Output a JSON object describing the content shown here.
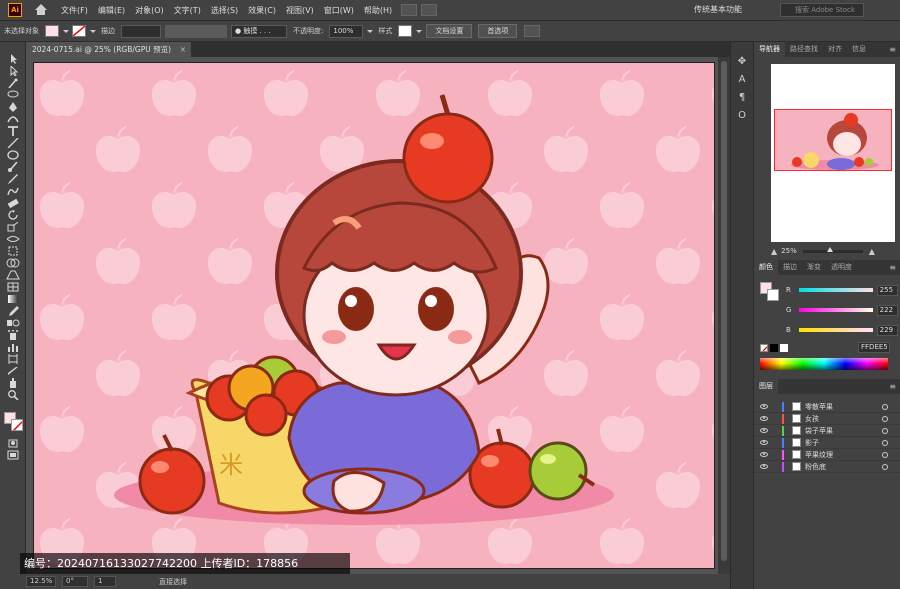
{
  "app": {
    "logo": "Ai"
  },
  "menus": [
    "文件(F)",
    "编辑(E)",
    "对象(O)",
    "文字(T)",
    "选择(S)",
    "效果(C)",
    "视图(V)",
    "窗口(W)",
    "帮助(H)"
  ],
  "workspace": "传统基本功能",
  "search_placeholder": "搜索 Adobe Stock",
  "control": {
    "no_selection": "未选择对象",
    "stroke_label": "描边",
    "brush": "触摸 . . .",
    "opacity_label": "不透明度:",
    "opacity_value": "100%",
    "style_label": "样式",
    "doc_setup": "文档设置",
    "prefs": "首选项"
  },
  "document_tab": {
    "title": "2024-0715.ai @ 25% (RGB/GPU 预览)",
    "close": "×"
  },
  "toolbar_icons": [
    "selection-tool-icon",
    "direct-selection-tool-icon",
    "magic-wand-icon",
    "lasso-icon",
    "pen-icon",
    "curvature-icon",
    "type-icon",
    "line-icon",
    "rectangle-icon",
    "paintbrush-icon",
    "pencil-icon",
    "shaper-icon",
    "eraser-icon",
    "rotate-icon",
    "scale-icon",
    "width-icon",
    "free-transform-icon",
    "shape-builder-icon",
    "perspective-icon",
    "mesh-icon",
    "gradient-icon",
    "eyedropper-icon",
    "blend-icon",
    "symbol-sprayer-icon",
    "graph-icon",
    "artboard-icon",
    "slice-icon",
    "hand-icon",
    "zoom-icon"
  ],
  "status": {
    "zoom": "12.5%",
    "angle": "0°",
    "artboard": "1",
    "mode": "直接选择"
  },
  "watermark": "编号：20240716133027742200   上传者ID：178856",
  "panels": {
    "top_tabs": [
      "导航器",
      "路径查找",
      "对齐",
      "信息"
    ],
    "nav_zoom": "25%",
    "color_tabs": [
      "颜色",
      "描边",
      "渐变",
      "透明度"
    ],
    "rgb": {
      "R": "255",
      "G": "222",
      "B": "229"
    },
    "hex": "FFDEE5",
    "layers_title": "图层",
    "layers": [
      {
        "name": "零散苹果",
        "color": "#4f7bff"
      },
      {
        "name": "女孩",
        "color": "#ff4f4f"
      },
      {
        "name": "袋子苹果",
        "color": "#4fd64f"
      },
      {
        "name": "影子",
        "color": "#4f7bff"
      },
      {
        "name": "苹果纹理",
        "color": "#ff4fff"
      },
      {
        "name": "粉色底",
        "color": "#c04fff"
      }
    ]
  },
  "colors": {
    "artboard_bg": "#f7b2c0",
    "fill": "#ffdee5",
    "accent": "#ff9a00"
  }
}
